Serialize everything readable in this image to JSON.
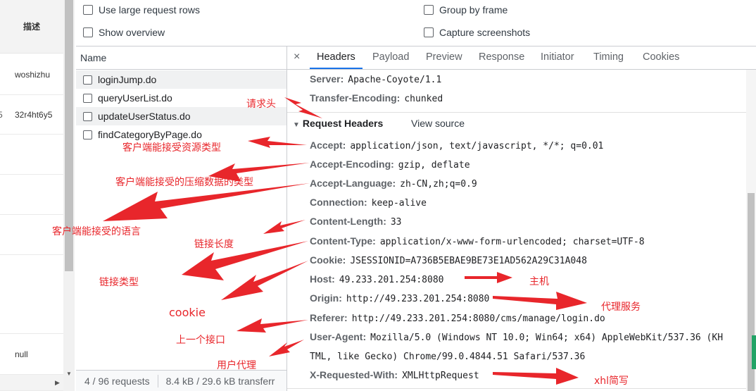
{
  "background_table": {
    "header": "描述",
    "rows": [
      {
        "value": "woshizhu",
        "prefix": ""
      },
      {
        "value": "32r4ht6y5",
        "prefix": "5"
      },
      {
        "value": "",
        "prefix": ""
      },
      {
        "value": "",
        "prefix": ""
      },
      {
        "value": "",
        "prefix": ""
      },
      {
        "value": "",
        "prefix": ""
      },
      {
        "value": "null",
        "prefix": ""
      }
    ]
  },
  "settings": {
    "large_rows": "Use large request rows",
    "show_overview": "Show overview",
    "group_by_frame": "Group by frame",
    "capture_screenshots": "Capture screenshots"
  },
  "name_panel": {
    "header": "Name",
    "requests": [
      "loginJump.do",
      "queryUserList.do",
      "updateUserStatus.do",
      "findCategoryByPage.do"
    ],
    "footer_requests": "4 / 96 requests",
    "footer_transfer": "8.4 kB / 29.6 kB transferr"
  },
  "tabs": {
    "close": "×",
    "items": [
      "Headers",
      "Payload",
      "Preview",
      "Response",
      "Initiator",
      "Timing",
      "Cookies"
    ],
    "active": "Headers"
  },
  "response_headers": [
    {
      "key": "Server:",
      "value": "Apache-Coyote/1.1"
    },
    {
      "key": "Transfer-Encoding:",
      "value": "chunked"
    }
  ],
  "request_section": {
    "title": "Request Headers",
    "view_source": "View source",
    "triangle": "▼"
  },
  "request_headers": [
    {
      "key": "Accept:",
      "value": "application/json, text/javascript, */*; q=0.01"
    },
    {
      "key": "Accept-Encoding:",
      "value": "gzip, deflate"
    },
    {
      "key": "Accept-Language:",
      "value": "zh-CN,zh;q=0.9"
    },
    {
      "key": "Connection:",
      "value": "keep-alive"
    },
    {
      "key": "Content-Length:",
      "value": "33"
    },
    {
      "key": "Content-Type:",
      "value": "application/x-www-form-urlencoded; charset=UTF-8"
    },
    {
      "key": "Cookie:",
      "value": "JSESSIONID=A736B5EBAE9BE73E1AD562A29C31A048"
    },
    {
      "key": "Host:",
      "value": "49.233.201.254:8080"
    },
    {
      "key": "Origin:",
      "value": "http://49.233.201.254:8080"
    },
    {
      "key": "Referer:",
      "value": "http://49.233.201.254:8080/cms/manage/login.do"
    },
    {
      "key": "User-Agent:",
      "value": "Mozilla/5.0 (Windows NT 10.0; Win64; x64) AppleWebKit/537.36 (KH"
    },
    {
      "key": "",
      "value": "TML, like Gecko) Chrome/99.0.4844.51 Safari/537.36"
    },
    {
      "key": "X-Requested-With:",
      "value": "XMLHttpRequest"
    }
  ],
  "annotations": {
    "request_header": "请求头",
    "accept_types": "客户端能接受资源类型",
    "compression": "客户端能接受的压缩数据的类型",
    "language": "客户端能接受的语言",
    "length": "链接长度",
    "type": "链接类型",
    "cookie": "cookie",
    "host": "主机",
    "proxy": "代理服务",
    "referer": "上一个接口",
    "user_agent": "用户代理",
    "xhl": "xhl简写"
  },
  "colors": {
    "accent": "#1a73e8",
    "annotation": "#e8262b"
  }
}
